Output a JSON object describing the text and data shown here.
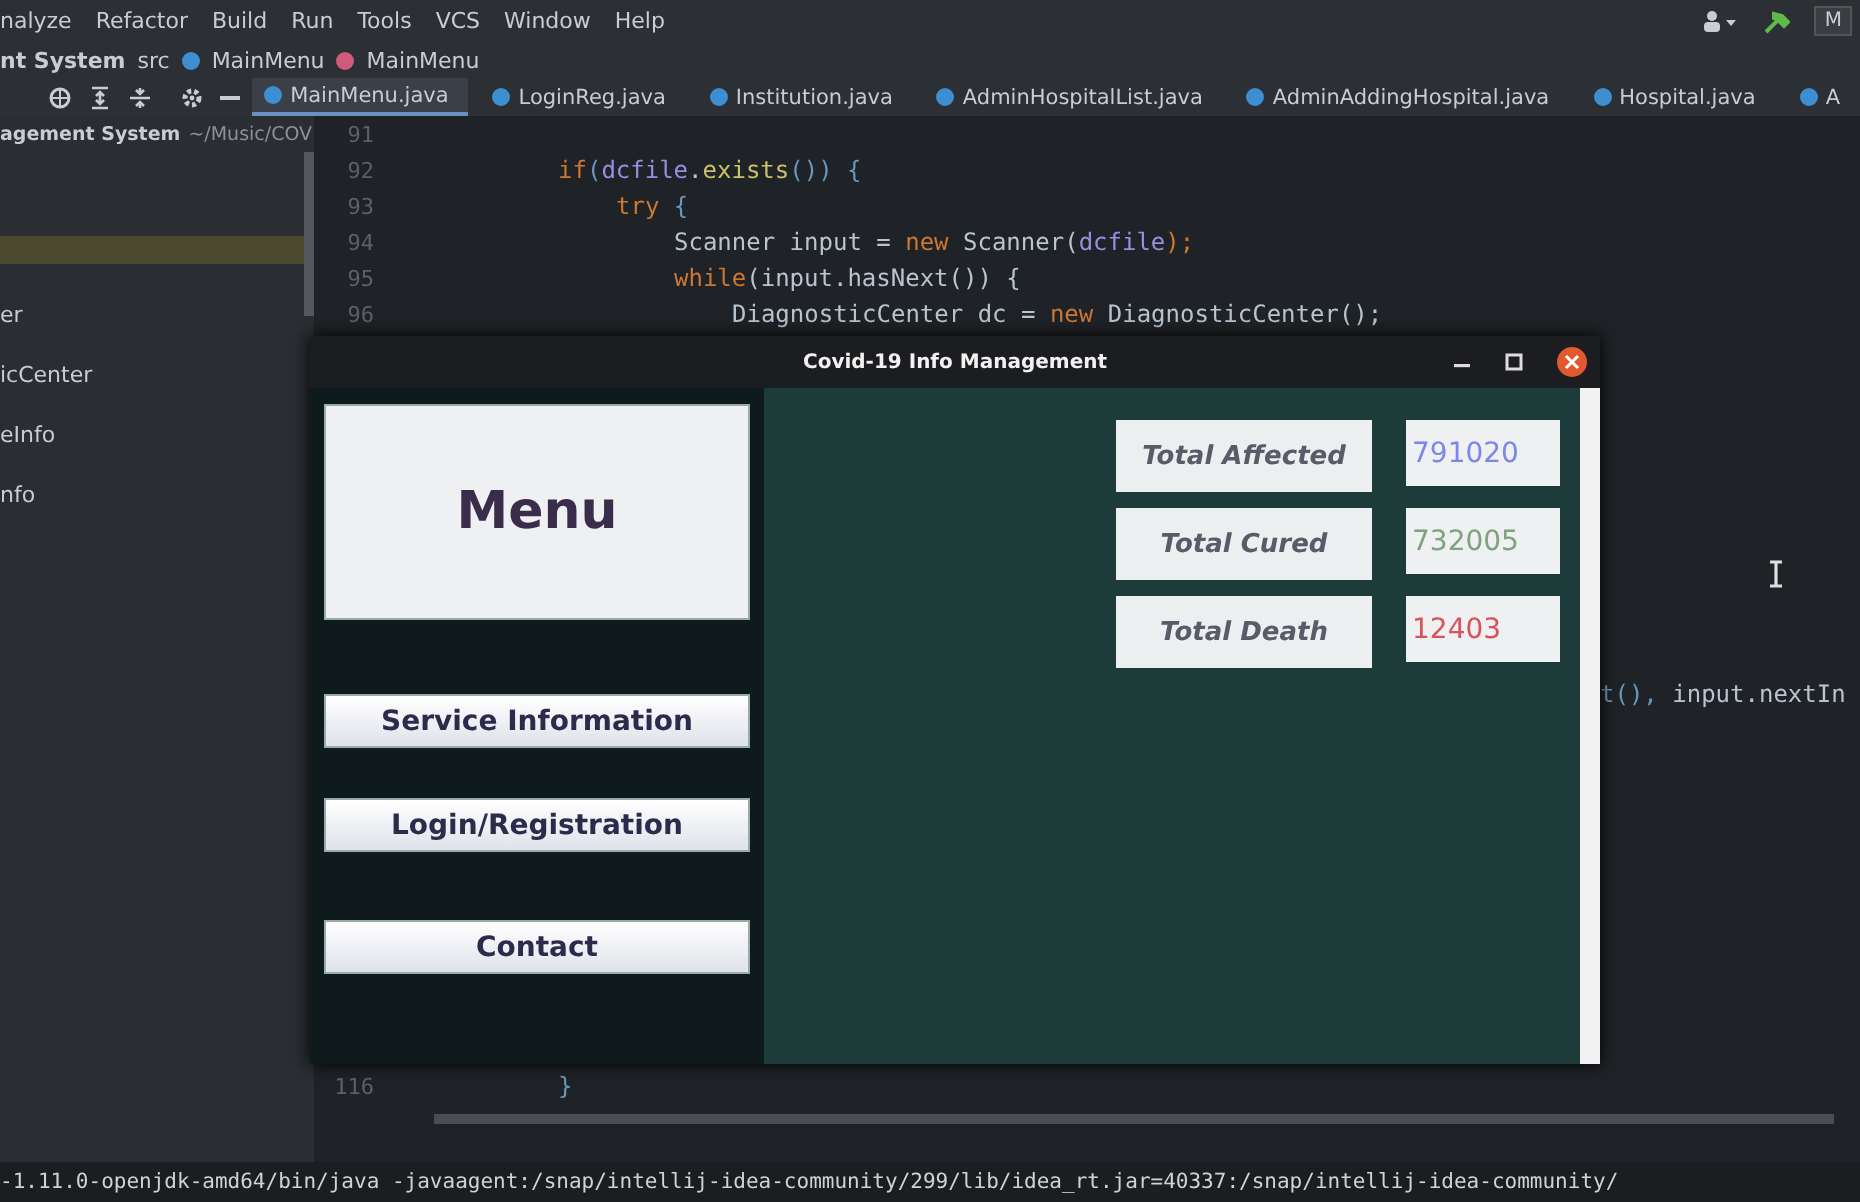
{
  "menu_bar": {
    "items": [
      "nalyze",
      "Refactor",
      "Build",
      "Run",
      "Tools",
      "VCS",
      "Window",
      "Help"
    ],
    "run_config": "M"
  },
  "breadcrumb": [
    {
      "label": "nt System",
      "kind": "project"
    },
    {
      "label": "src",
      "kind": "folder"
    },
    {
      "label": "MainMenu",
      "kind": "class"
    },
    {
      "label": "MainMenu",
      "kind": "method"
    }
  ],
  "tabs": [
    {
      "label": "MainMenu.java",
      "selected": true
    },
    {
      "label": "LoginReg.java",
      "selected": false
    },
    {
      "label": "Institution.java",
      "selected": false
    },
    {
      "label": "AdminHospitalList.java",
      "selected": false
    },
    {
      "label": "AdminAddingHospital.java",
      "selected": false
    },
    {
      "label": "Hospital.java",
      "selected": false
    },
    {
      "label": "A",
      "selected": false
    }
  ],
  "project_tree": {
    "title": "agement System",
    "path": "~/Music/COV",
    "items": [
      "er",
      "icCenter",
      "eInfo",
      "nfo"
    ]
  },
  "editor": {
    "lines": [
      {
        "number": "91"
      },
      {
        "number": "92",
        "tokens": [
          {
            "text": "if",
            "kind": "keyword"
          },
          {
            "text": "(",
            "kind": "brace"
          },
          {
            "text": "dcfile",
            "kind": "field"
          },
          {
            "text": ".",
            "kind": "plain"
          },
          {
            "text": "exists",
            "kind": "method"
          },
          {
            "text": "()) {",
            "kind": "brace"
          }
        ],
        "children": [
          {
            "number": "93",
            "tokens": [
              {
                "text": "try",
                "kind": "keyword"
              },
              {
                "text": " {",
                "kind": "brace"
              }
            ],
            "children": [
              {
                "number": "94",
                "tokens": [
                  {
                    "text": "Scanner input = ",
                    "kind": "plain"
                  },
                  {
                    "text": "new",
                    "kind": "keyword"
                  },
                  {
                    "text": " Scanner(",
                    "kind": "plain"
                  },
                  {
                    "text": "dcfile",
                    "kind": "field"
                  },
                  {
                    "text": ");",
                    "kind": "keyword"
                  }
                ]
              },
              {
                "number": "95",
                "tokens": [
                  {
                    "text": "while",
                    "kind": "keyword"
                  },
                  {
                    "text": "(input.hasNext()) {",
                    "kind": "plain"
                  }
                ],
                "children": [
                  {
                    "number": "96",
                    "tokens": [
                      {
                        "text": "DiagnosticCenter dc = ",
                        "kind": "plain"
                      },
                      {
                        "text": "new",
                        "kind": "keyword"
                      },
                      {
                        "text": " DiagnosticCenter();",
                        "kind": "plain"
                      }
                    ]
                  }
                ]
              }
            ]
          }
        ]
      }
    ],
    "fragment": {
      "tokens": [
        {
          "text": "t(), ",
          "kind": "brace"
        },
        {
          "text": "input.nextIn",
          "kind": "plain"
        }
      ]
    },
    "last_line": {
      "number": "116",
      "tokens": [
        {
          "text": "}",
          "kind": "brace"
        }
      ]
    }
  },
  "console": "-1.11.0-openjdk-amd64/bin/java -javaagent:/snap/intellij-idea-community/299/lib/idea_rt.jar=40337:/snap/intellij-idea-community/",
  "app_window": {
    "title": "Covid-19 Info Management",
    "menu_title": "Menu",
    "buttons": [
      "Service Information",
      "Login/Registration",
      "Contact"
    ],
    "stats": [
      {
        "label": "Total Affected",
        "value": "791020",
        "color": "#7b86e8"
      },
      {
        "label": "Total Cured",
        "value": "732005",
        "color": "#7ea37e"
      },
      {
        "label": "Total Death",
        "value": "12403",
        "color": "#d9545a"
      }
    ]
  }
}
